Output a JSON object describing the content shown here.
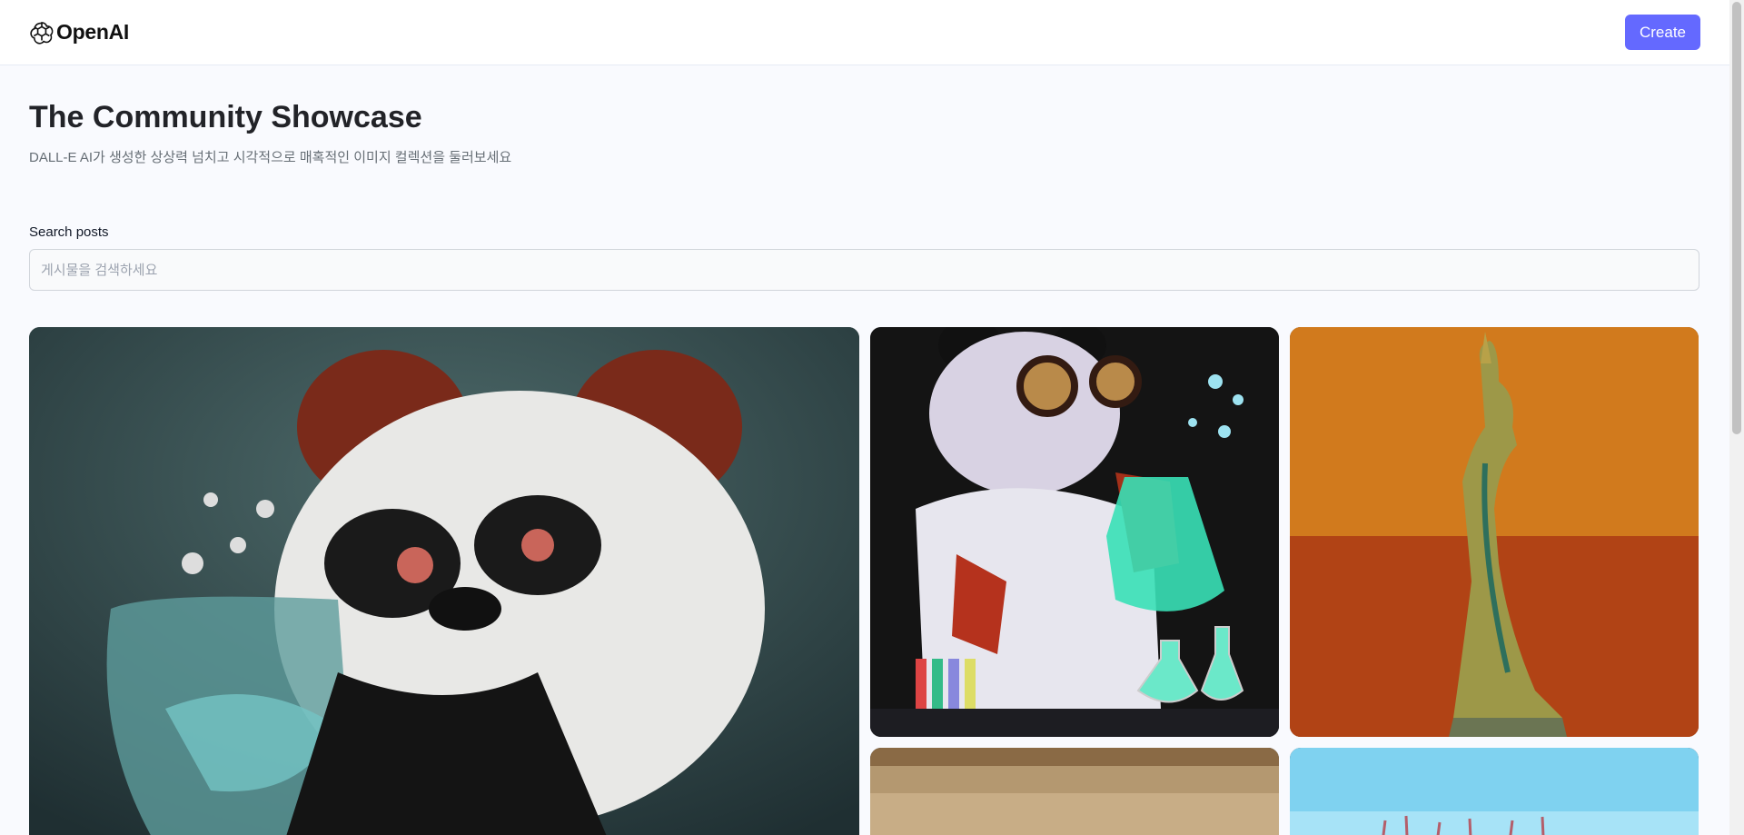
{
  "header": {
    "brand": "OpenAI",
    "create_label": "Create",
    "accent_color": "#6469ff"
  },
  "main": {
    "title": "The Community Showcase",
    "subtitle": "DALL-E AI가 생성한 상상력 넘치고 시각적으로 매혹적인 이미지 컬렉션을 둘러보세요",
    "search": {
      "label": "Search posts",
      "placeholder": "게시물을 검색하세요",
      "value": ""
    }
  },
  "icons": {
    "logo": "openai-logo-icon"
  }
}
